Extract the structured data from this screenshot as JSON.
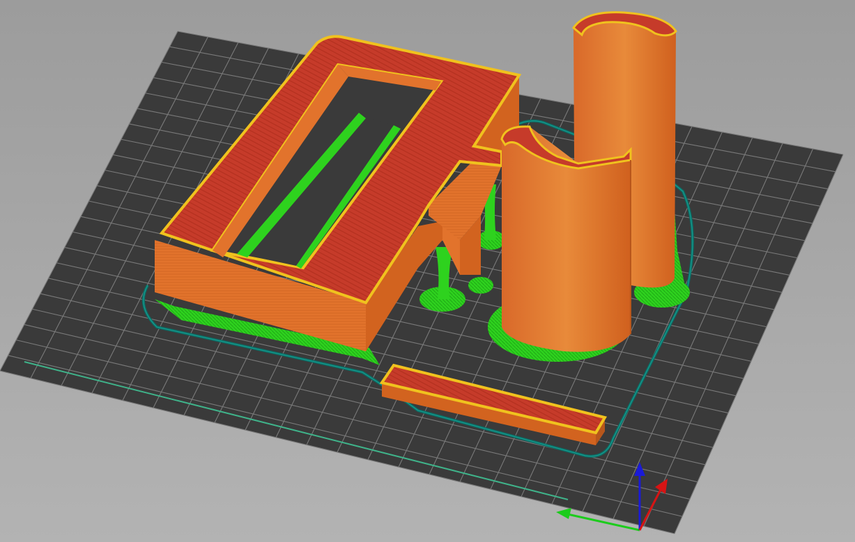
{
  "window": {
    "title": ""
  },
  "colors": {
    "background_top": "#9c9c9c",
    "background_bottom": "#b3b3b3",
    "bed": "#3a3a3a",
    "bed_grid": "#7a7a7a",
    "external_perimeter": "#e2732c",
    "top_solid_infill": "#c63b2a",
    "inner_perimeter": "#f0c21e",
    "support_material": "#2ed21e",
    "skirt": "#0a6e66",
    "axis_x": "#d61414",
    "axis_y": "#1ccc1c",
    "axis_z": "#1a1ad8"
  },
  "scene": {
    "objects": [
      {
        "name": "large-frame-part"
      },
      {
        "name": "small-bar-part"
      },
      {
        "name": "cylinder-tower-part"
      }
    ],
    "features": [
      "external-perimeter",
      "top-solid-infill",
      "support-material",
      "skirt"
    ]
  },
  "axes": {
    "visible": true
  }
}
